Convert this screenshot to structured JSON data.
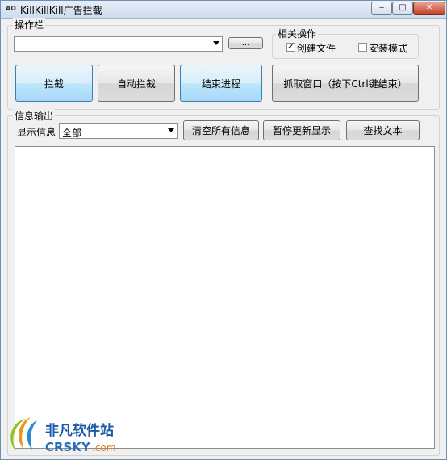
{
  "window": {
    "title": "KillKillKill广告拦截",
    "icon_text": "AD",
    "controls": {
      "minimize": "‒",
      "maximize": "□",
      "close": "✕"
    }
  },
  "toolbar": {
    "group_label": "操作栏",
    "combo_value": "",
    "browse_label": "...",
    "related": {
      "group_label": "相关操作",
      "create_file": {
        "label": "创建文件",
        "checked": true
      },
      "install_mode": {
        "label": "安装模式",
        "checked": false
      }
    },
    "buttons": {
      "block": "拦截",
      "auto_block": "自动拦截",
      "end_process": "结束进程",
      "capture_window": "抓取窗口（按下Ctrl键结束）"
    }
  },
  "info": {
    "group_label": "信息输出",
    "show_label": "显示信息",
    "filter_value": "全部",
    "buttons": {
      "clear": "清空所有信息",
      "pause": "暂停更新显示",
      "find": "查找文本"
    },
    "output_text": ""
  },
  "watermark": {
    "name": "非凡软件站",
    "site_prefix": "CRSKY",
    "site_suffix": ".com"
  }
}
